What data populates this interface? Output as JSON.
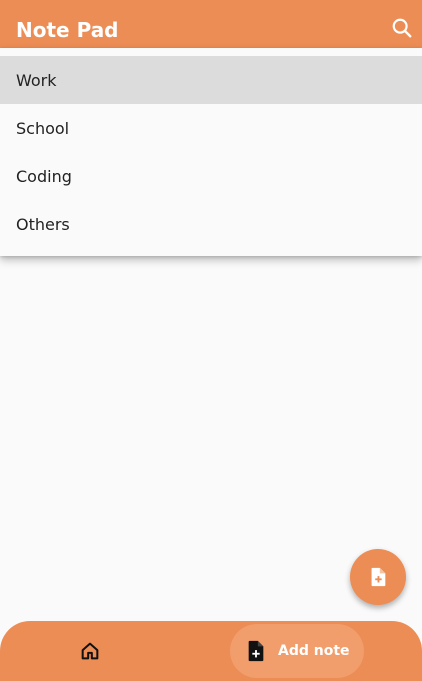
{
  "app_bar": {
    "title": "Note Pad",
    "search_icon": "search-icon",
    "color": "#ec8d55"
  },
  "menu": {
    "items": [
      {
        "label": "Work",
        "active": true
      },
      {
        "label": "School",
        "active": false
      },
      {
        "label": "Coding",
        "active": false
      },
      {
        "label": "Others",
        "active": false
      }
    ]
  },
  "fab": {
    "icon": "add-note-icon"
  },
  "bottom_nav": {
    "home_icon": "home-icon",
    "add_note_label": "Add note",
    "add_note_icon": "add-note-icon",
    "pill_color": "#f19e6c"
  }
}
